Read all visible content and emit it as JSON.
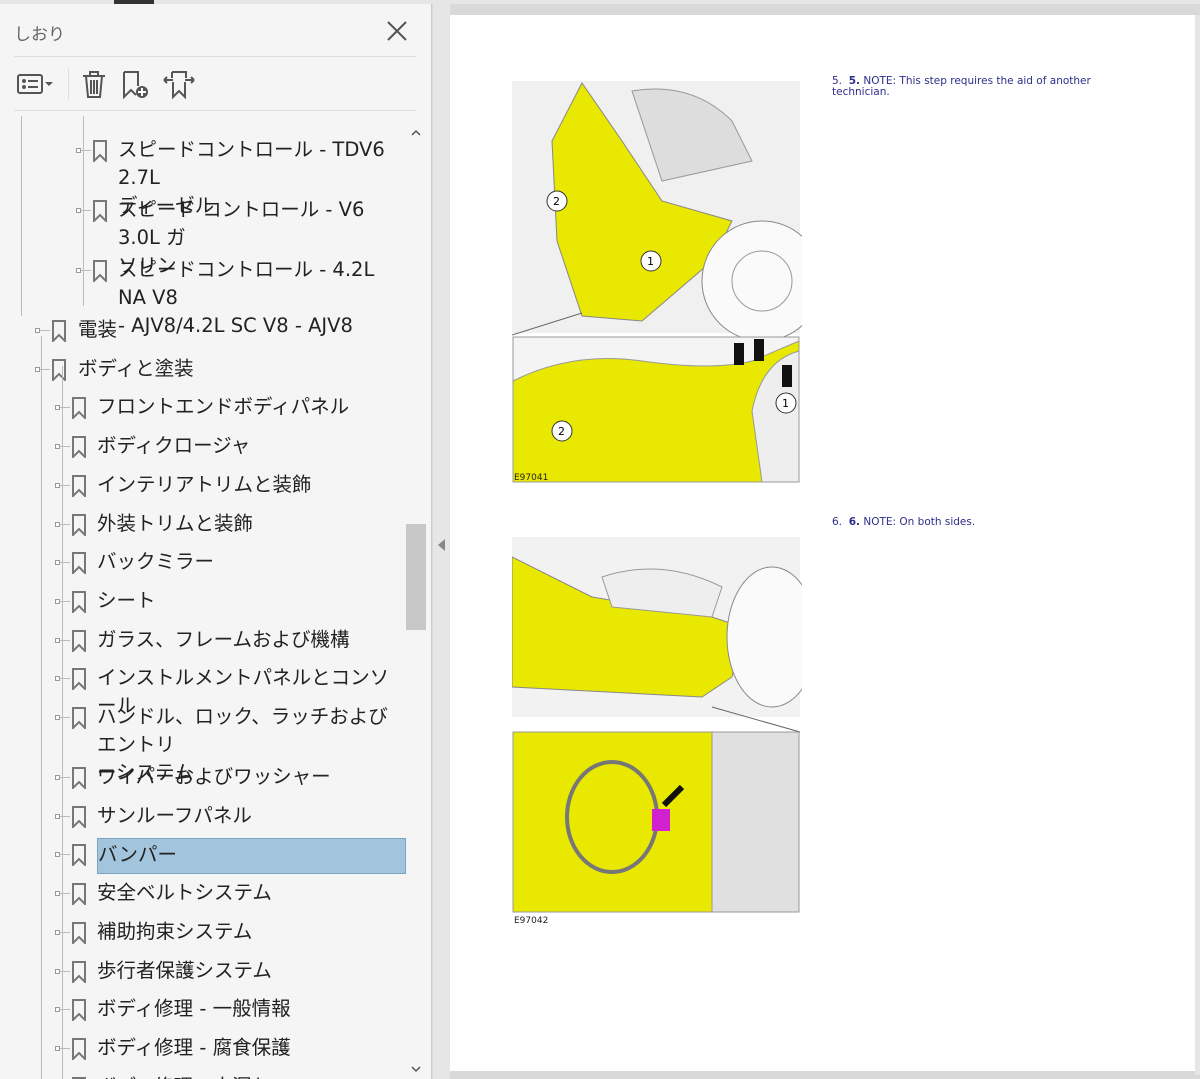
{
  "sidebar": {
    "title": "しおり",
    "tree": [
      {
        "label": "スピードコントロール - TDV6 2.7L ディーゼル",
        "lines": [
          "スピードコントロール - TDV6 2.7L",
          "ディーゼル"
        ]
      },
      {
        "label": "スピード コントロール - V6 3.0L ガソリン",
        "lines": [
          "スピード コントロール - V6 3.0L ガ",
          "ソリン"
        ]
      },
      {
        "label": "スピードコントロール - 4.2L NA V8 - AJV8/4.2L SC V8 - AJV8",
        "lines": [
          "スピードコントロール - 4.2L NA V8",
          "- AJV8/4.2L SC V8 - AJV8"
        ]
      },
      {
        "label": "電装"
      },
      {
        "label": "ボディと塗装"
      },
      {
        "label": "フロントエンドボディパネル"
      },
      {
        "label": "ボディクロージャ"
      },
      {
        "label": "インテリアトリムと装飾"
      },
      {
        "label": "外装トリムと装飾"
      },
      {
        "label": "バックミラー"
      },
      {
        "label": "シート"
      },
      {
        "label": "ガラス、フレームおよび機構"
      },
      {
        "label": "インストルメントパネルとコンソール"
      },
      {
        "label": "ハンドル、ロック、ラッチおよびエントリーシステム",
        "lines": [
          "ハンドル、ロック、ラッチおよびエントリ",
          "ーシステム"
        ]
      },
      {
        "label": "ワイパーおよびワッシャー"
      },
      {
        "label": "サンルーフパネル"
      },
      {
        "label": "バンパー",
        "selected": true
      },
      {
        "label": "安全ベルトシステム"
      },
      {
        "label": "補助拘束システム"
      },
      {
        "label": "歩行者保護システム"
      },
      {
        "label": "ボディ修理 - 一般情報"
      },
      {
        "label": "ボディ修理 - 腐食保護"
      },
      {
        "label": "ボディ修理 - 水漏れ"
      }
    ]
  },
  "document": {
    "step5": {
      "num": "5.",
      "num2": "5.",
      "text": "NOTE: This step requires the aid of another technician."
    },
    "step6": {
      "num": "6.",
      "num2": "6.",
      "text": "NOTE: On both sides."
    },
    "fig1_id": "E97041",
    "fig2_id": "E97042",
    "callouts": [
      "1",
      "2"
    ]
  },
  "colors": {
    "highlight": "#a3c4dd",
    "yellow": "#e8e800",
    "note": "#2d2d8a"
  }
}
